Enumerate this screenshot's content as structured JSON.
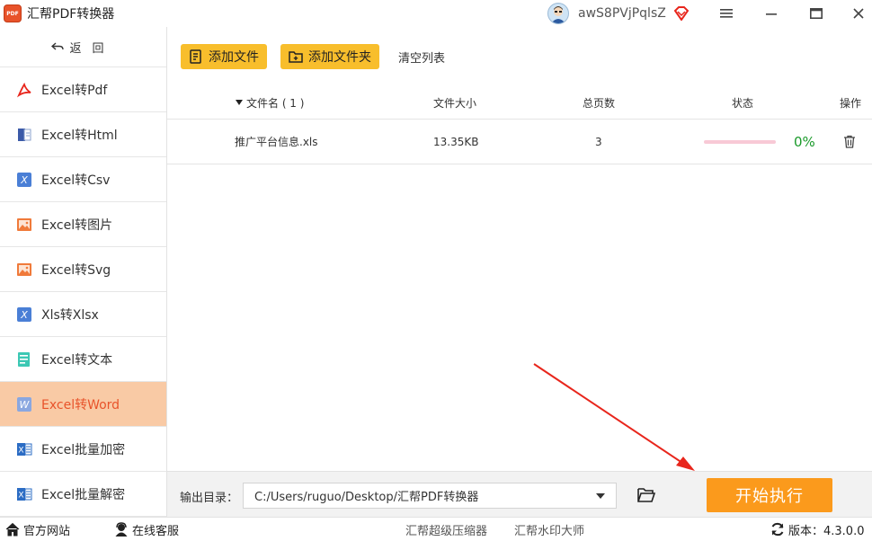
{
  "app": {
    "title": "汇帮PDF转换器",
    "logo_text": "PDF",
    "user_name": "awS8PVjPqlsZ"
  },
  "sidebar": {
    "back_label": "返回",
    "items": [
      {
        "label": "Excel转Pdf",
        "icon": "pdf-icon",
        "active": false
      },
      {
        "label": "Excel转Html",
        "icon": "html-icon",
        "active": false
      },
      {
        "label": "Excel转Csv",
        "icon": "csv-icon",
        "active": false
      },
      {
        "label": "Excel转图片",
        "icon": "image-icon",
        "active": false
      },
      {
        "label": "Excel转Svg",
        "icon": "svg-icon",
        "active": false
      },
      {
        "label": "Xls转Xlsx",
        "icon": "xlsx-icon",
        "active": false
      },
      {
        "label": "Excel转文本",
        "icon": "text-icon",
        "active": false
      },
      {
        "label": "Excel转Word",
        "icon": "word-icon",
        "active": true
      },
      {
        "label": "Excel批量加密",
        "icon": "encrypt-icon",
        "active": false
      },
      {
        "label": "Excel批量解密",
        "icon": "decrypt-icon",
        "active": false
      }
    ]
  },
  "toolbar": {
    "add_file": "添加文件",
    "add_folder": "添加文件夹",
    "clear_list": "清空列表"
  },
  "table": {
    "headers": {
      "name": "文件名 ( 1 )",
      "size": "文件大小",
      "pages": "总页数",
      "status": "状态",
      "action": "操作"
    },
    "rows": [
      {
        "name": "推广平台信息.xls",
        "size": "13.35KB",
        "pages": "3",
        "progress_percent": 0,
        "progress_label": "0%"
      }
    ]
  },
  "output": {
    "label": "输出目录：",
    "path": "C:/Users/ruguo/Desktop/汇帮PDF转换器",
    "start_label": "开始执行"
  },
  "statusbar": {
    "website": "官方网站",
    "support": "在线客服",
    "compressor": "汇帮超级压缩器",
    "watermark": "汇帮水印大师",
    "version": "版本：4.3.0.0"
  },
  "colors": {
    "accent": "#f8be2c",
    "start_button": "#fb9a1c",
    "active_item_bg": "#f9caa5",
    "active_item_text": "#e8532a",
    "progress_text": "#1a9a2a",
    "annotation_arrow": "#e8261c"
  }
}
